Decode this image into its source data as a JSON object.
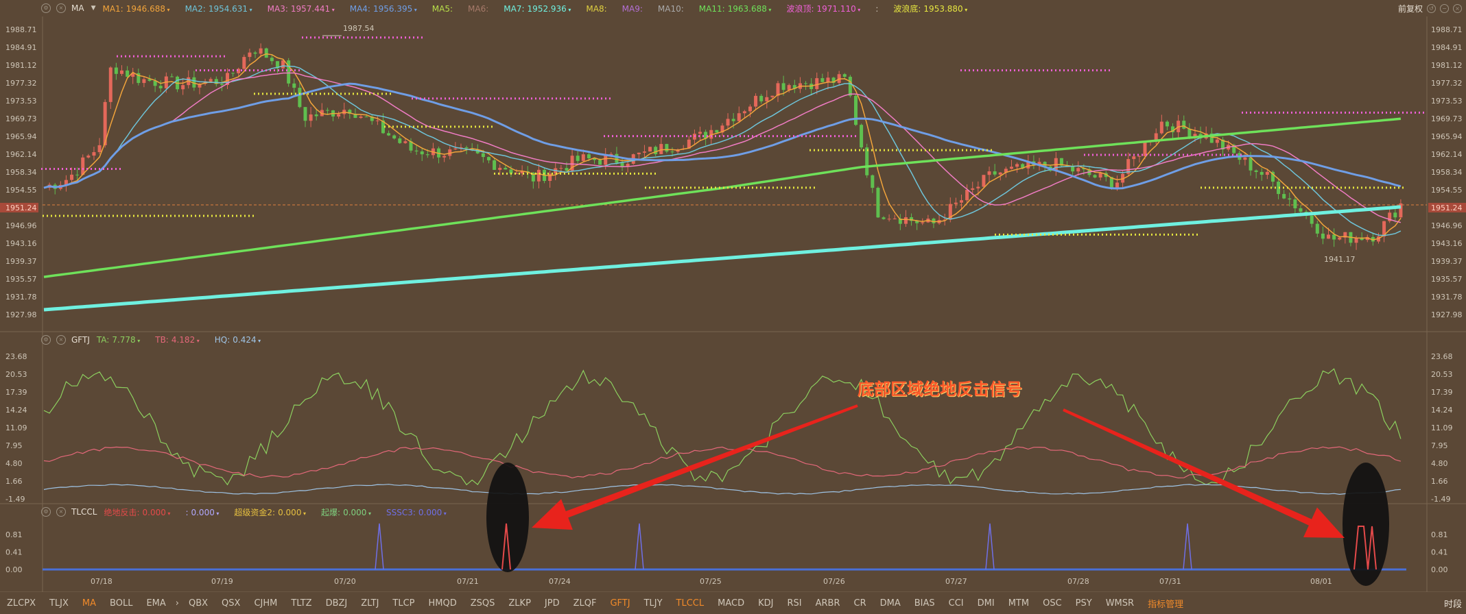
{
  "colors": {
    "bg": "#5b4836",
    "candle_up": "#e4685a",
    "candle_down": "#5fbf4f",
    "annot": "#ff5a2a"
  },
  "main_panel": {
    "indicator": "MA",
    "items": [
      {
        "label": "MA1:",
        "value": "1946.688",
        "color": "#f2a43b"
      },
      {
        "label": "MA2:",
        "value": "1954.631",
        "color": "#6ec4d9"
      },
      {
        "label": "MA3:",
        "value": "1957.441",
        "color": "#f07cc4"
      },
      {
        "label": "MA4:",
        "value": "1956.395",
        "color": "#6f9ee6"
      },
      {
        "label": "MA5:",
        "value": "",
        "color": "#b8df4a"
      },
      {
        "label": "MA6:",
        "value": "",
        "color": "#a77a6a"
      },
      {
        "label": "MA7:",
        "value": "1952.936",
        "color": "#6ff0e0"
      },
      {
        "label": "MA8:",
        "value": "",
        "color": "#e0d040"
      },
      {
        "label": "MA9:",
        "value": "",
        "color": "#b470d6"
      },
      {
        "label": "MA10:",
        "value": "",
        "color": "#a9a9a9"
      },
      {
        "label": "MA11:",
        "value": "1963.688",
        "color": "#6fe15a"
      },
      {
        "label": "波浪顶:",
        "value": "1971.110",
        "color": "#f060d8"
      },
      {
        "label": ":",
        "value": "",
        "color": "#cfc6b8"
      },
      {
        "label": "波浪底:",
        "value": "1953.880",
        "color": "#e6e640"
      }
    ],
    "y_labels": [
      "1988.71",
      "1984.91",
      "1981.12",
      "1977.32",
      "1973.53",
      "1969.73",
      "1965.94",
      "1962.14",
      "1958.34",
      "1954.55",
      "1951.24",
      "1946.96",
      "1943.16",
      "1939.37",
      "1935.57",
      "1931.78",
      "1927.98"
    ],
    "price_high": "1987.54",
    "price_low": "1941.17",
    "current": "1951.24"
  },
  "right_top": "前复权",
  "gftj_panel": {
    "indicator": "GFTJ",
    "items": [
      {
        "label": "TA:",
        "value": "7.778",
        "color": "#8ccf5f"
      },
      {
        "label": "TB:",
        "value": "4.182",
        "color": "#e4687a"
      },
      {
        "label": "HQ:",
        "value": "0.424",
        "color": "#9fc4e6"
      }
    ],
    "y_labels": [
      "23.68",
      "20.53",
      "17.39",
      "14.24",
      "11.09",
      "7.95",
      "4.80",
      "1.66",
      "-1.49"
    ]
  },
  "tlccl_panel": {
    "indicator": "TLCCL",
    "items": [
      {
        "label": "绝地反击:",
        "value": "0.000",
        "color": "#e44a4a"
      },
      {
        "label": ":",
        "value": "0.000",
        "color": "#b0a8ff"
      },
      {
        "label": "超级资金2:",
        "value": "0.000",
        "color": "#e6c040"
      },
      {
        "label": "起爆:",
        "value": "0.000",
        "color": "#7fd07f"
      },
      {
        "label": "SSSC3:",
        "value": "0.000",
        "color": "#6f6fe6"
      }
    ],
    "y_labels": [
      "0.81",
      "0.41",
      "0.00"
    ]
  },
  "dates": [
    "07/18",
    "07/19",
    "07/20",
    "07/21",
    "07/24",
    "07/25",
    "07/26",
    "07/27",
    "07/28",
    "07/31",
    "08/01"
  ],
  "annotation": "底部区域绝地反击信号",
  "tabs": [
    "ZLCPX",
    "TLJX",
    "MA",
    "BOLL",
    "EMA",
    "QBX",
    "QSX",
    "CJHM",
    "TLTZ",
    "DBZJ",
    "ZLTJ",
    "TLCP",
    "HMQD",
    "ZSQS",
    "ZLKP",
    "JPD",
    "ZLQF",
    "GFTJ",
    "TLJY",
    "TLCCL",
    "MACD",
    "KDJ",
    "RSI",
    "ARBR",
    "CR",
    "DMA",
    "BIAS",
    "CCI",
    "DMI",
    "MTM",
    "OSC",
    "PSY",
    "WMSR"
  ],
  "active_tabs": [
    "MA",
    "GFTJ",
    "TLCCL"
  ],
  "manage": "指标管理",
  "time_label": "时段"
}
